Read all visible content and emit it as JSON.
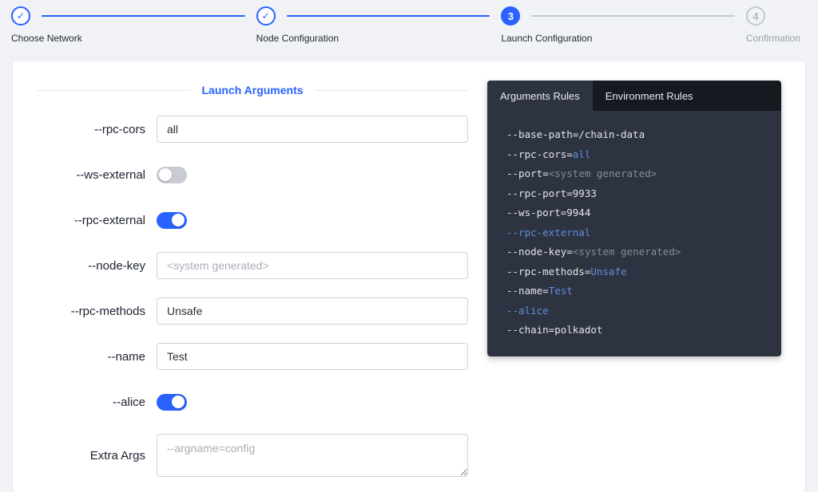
{
  "colors": {
    "accent": "#2962ff",
    "pending_gray": "#c3c8d2",
    "panel_bg": "#2d3340",
    "tabbar_bg": "#16191f",
    "code": {
      "light": "#e3e5e8",
      "blue": "#5f8fdc",
      "gray": "#868c97"
    }
  },
  "stepper": {
    "steps": [
      {
        "label": "Choose Network",
        "state": "done",
        "number": "1"
      },
      {
        "label": "Node Configuration",
        "state": "done",
        "number": "2"
      },
      {
        "label": "Launch Configuration",
        "state": "active",
        "number": "3"
      },
      {
        "label": "Confirmation",
        "state": "pending",
        "number": "4"
      }
    ]
  },
  "form": {
    "title": "Launch Arguments",
    "fields": [
      {
        "label": "--rpc-cors",
        "type": "text",
        "value": "all",
        "placeholder": ""
      },
      {
        "label": "--ws-external",
        "type": "toggle",
        "on": false
      },
      {
        "label": "--rpc-external",
        "type": "toggle",
        "on": true
      },
      {
        "label": "--node-key",
        "type": "text",
        "value": "",
        "placeholder": "<system generated>"
      },
      {
        "label": "--rpc-methods",
        "type": "text",
        "value": "Unsafe",
        "placeholder": ""
      },
      {
        "label": "--name",
        "type": "text",
        "value": "Test",
        "placeholder": ""
      },
      {
        "label": "--alice",
        "type": "toggle",
        "on": true
      },
      {
        "label": "Extra Args",
        "type": "textarea",
        "value": "",
        "placeholder": "--argname=config"
      }
    ]
  },
  "rules_panel": {
    "tabs": [
      {
        "label": "Arguments Rules",
        "active": true
      },
      {
        "label": "Environment Rules",
        "active": false
      }
    ],
    "lines": [
      {
        "segments": [
          {
            "text": "--base-path=/chain-data",
            "color": "light"
          }
        ]
      },
      {
        "segments": [
          {
            "text": "--rpc-cors=",
            "color": "light"
          },
          {
            "text": "all",
            "color": "blue"
          }
        ]
      },
      {
        "segments": [
          {
            "text": "--port=",
            "color": "light"
          },
          {
            "text": "<system generated>",
            "color": "gray"
          }
        ]
      },
      {
        "segments": [
          {
            "text": "--rpc-port=9933",
            "color": "light"
          }
        ]
      },
      {
        "segments": [
          {
            "text": "--ws-port=9944",
            "color": "light"
          }
        ]
      },
      {
        "segments": [
          {
            "text": "--rpc-external",
            "color": "blue"
          }
        ]
      },
      {
        "segments": [
          {
            "text": "--node-key=",
            "color": "light"
          },
          {
            "text": "<system generated>",
            "color": "gray"
          }
        ]
      },
      {
        "segments": [
          {
            "text": "--rpc-methods=",
            "color": "light"
          },
          {
            "text": "Unsafe",
            "color": "blue"
          }
        ]
      },
      {
        "segments": [
          {
            "text": "--name=",
            "color": "light"
          },
          {
            "text": "Test",
            "color": "blue"
          }
        ]
      },
      {
        "segments": [
          {
            "text": "--alice",
            "color": "blue"
          }
        ]
      },
      {
        "segments": [
          {
            "text": "--chain=polkadot",
            "color": "light"
          }
        ]
      }
    ]
  }
}
